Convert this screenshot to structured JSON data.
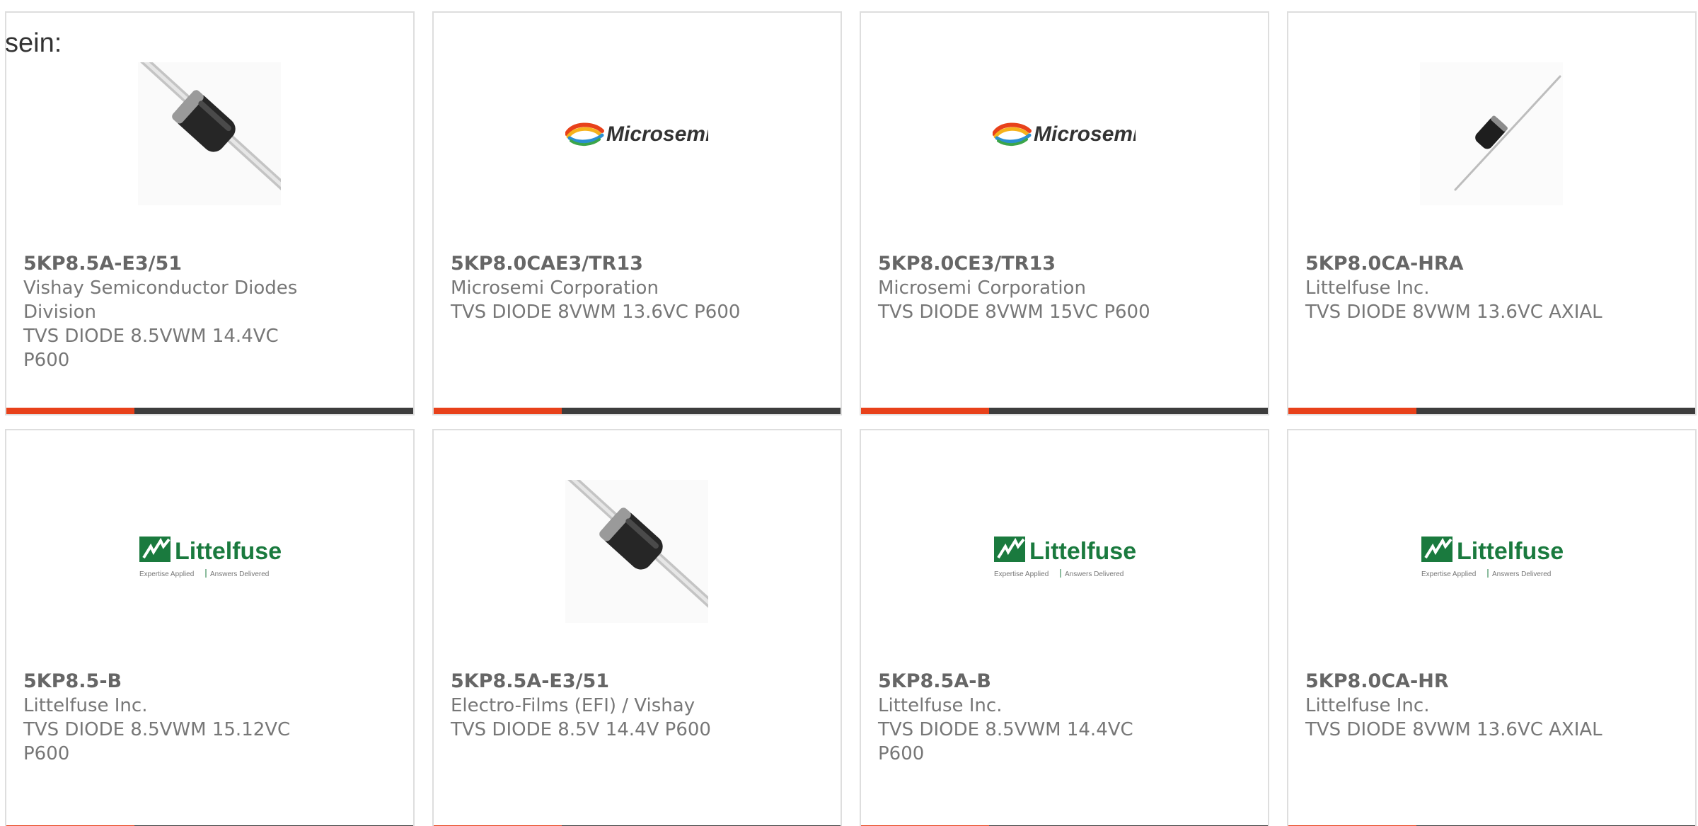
{
  "heading": "sein:",
  "brand_colors": {
    "accent": "#e8411a",
    "bar": "#3d3d3d",
    "border": "#dedede",
    "text": "#777777",
    "microsemi_text": "#333333",
    "littelfuse_green": "#1a7a3e"
  },
  "logo_text": {
    "microsemi": "Microsemi",
    "littelfuse": "Littelfuse",
    "littelfuse_tagline_left": "Expertise Applied",
    "littelfuse_tagline_right": "Answers Delivered"
  },
  "cards": [
    {
      "image": "diode-image",
      "part_number": "5KP8.5A-E3/51",
      "manufacturer": "Vishay Semiconductor Diodes Division",
      "description": "TVS DIODE 8.5VWM 14.4VC P600"
    },
    {
      "image": "microsemi-logo",
      "part_number": "5KP8.0CAE3/TR13",
      "manufacturer": "Microsemi Corporation",
      "description": "TVS DIODE 8VWM 13.6VC P600"
    },
    {
      "image": "microsemi-logo",
      "part_number": "5KP8.0CE3/TR13",
      "manufacturer": "Microsemi Corporation",
      "description": "TVS DIODE 8VWM 15VC P600"
    },
    {
      "image": "small-diode-image",
      "part_number": "5KP8.0CA-HRA",
      "manufacturer": "Littelfuse Inc.",
      "description": "TVS DIODE 8VWM 13.6VC AXIAL"
    },
    {
      "image": "littelfuse-logo",
      "part_number": "5KP8.5-B",
      "manufacturer": "Littelfuse Inc.",
      "description": "TVS DIODE 8.5VWM 15.12VC P600"
    },
    {
      "image": "diode-image",
      "part_number": "5KP8.5A-E3/51",
      "manufacturer": "Electro-Films (EFI) / Vishay",
      "description": "TVS DIODE 8.5V 14.4V P600"
    },
    {
      "image": "littelfuse-logo",
      "part_number": "5KP8.5A-B",
      "manufacturer": "Littelfuse Inc.",
      "description": "TVS DIODE 8.5VWM 14.4VC P600"
    },
    {
      "image": "littelfuse-logo",
      "part_number": "5KP8.0CA-HR",
      "manufacturer": "Littelfuse Inc.",
      "description": "TVS DIODE 8VWM 13.6VC AXIAL"
    }
  ]
}
